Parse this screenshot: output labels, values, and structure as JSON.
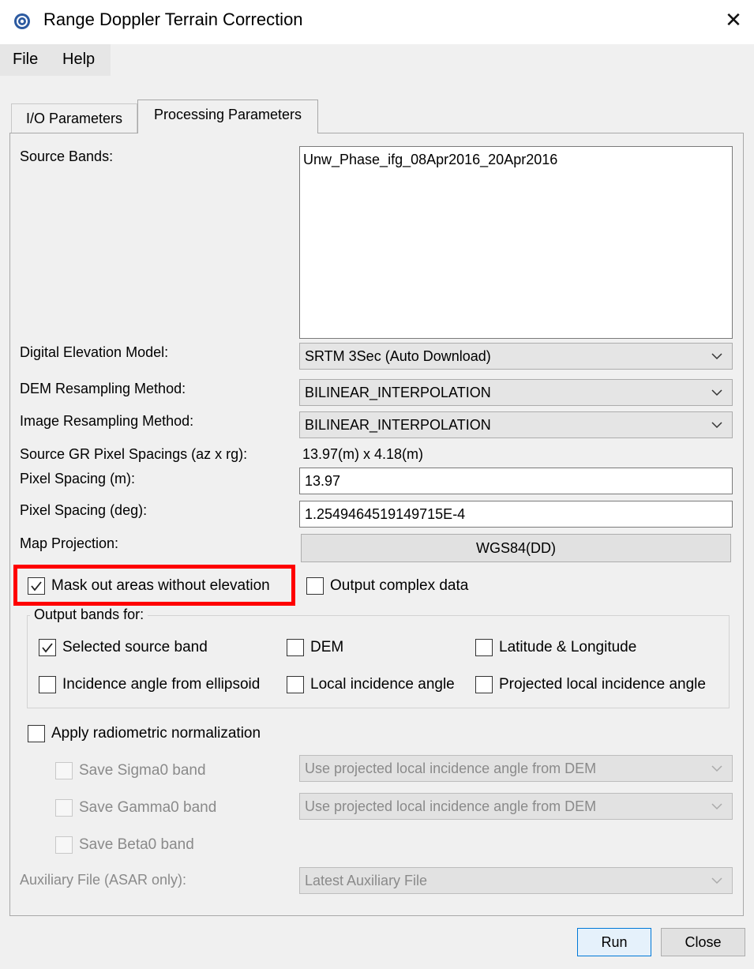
{
  "window": {
    "title": "Range Doppler Terrain Correction",
    "close_glyph": "✕"
  },
  "menu": {
    "file": "File",
    "help": "Help"
  },
  "tabs": {
    "io": "I/O Parameters",
    "processing": "Processing Parameters"
  },
  "form": {
    "source_bands_label": "Source Bands:",
    "source_bands": [
      "Unw_Phase_ifg_08Apr2016_20Apr2016"
    ],
    "dem_label": "Digital Elevation Model:",
    "dem_value": "SRTM 3Sec (Auto Download)",
    "dem_resampling_label": "DEM Resampling Method:",
    "dem_resampling_value": "BILINEAR_INTERPOLATION",
    "image_resampling_label": "Image Resampling Method:",
    "image_resampling_value": "BILINEAR_INTERPOLATION",
    "gr_spacing_label": "Source GR Pixel Spacings (az x rg):",
    "gr_spacing_value": "13.97(m) x 4.18(m)",
    "pixel_spacing_m_label": "Pixel Spacing (m):",
    "pixel_spacing_m_value": "13.97",
    "pixel_spacing_deg_label": "Pixel Spacing (deg):",
    "pixel_spacing_deg_value": "1.2549464519149715E-4",
    "map_projection_label": "Map Projection:",
    "map_projection_button": "WGS84(DD)",
    "mask_label": "Mask out areas without elevation",
    "mask_checked": true,
    "complex_label": "Output complex data",
    "complex_checked": false,
    "output_bands_title": "Output bands for:",
    "selected_source_label": "Selected source band",
    "selected_source_checked": true,
    "dem_band_label": "DEM",
    "latlon_label": "Latitude & Longitude",
    "incidence_ellipsoid_label": "Incidence angle from ellipsoid",
    "local_incidence_label": "Local incidence angle",
    "projected_local_label": "Projected local incidence angle",
    "radiometric_label": "Apply radiometric normalization",
    "sigma0_label": "Save Sigma0 band",
    "sigma0_combo": "Use projected local incidence angle from DEM",
    "gamma0_label": "Save Gamma0 band",
    "gamma0_combo": "Use projected local incidence angle from DEM",
    "beta0_label": "Save Beta0 band",
    "aux_label": "Auxiliary File (ASAR only):",
    "aux_combo": "Latest Auxiliary File"
  },
  "buttons": {
    "run": "Run",
    "close": "Close"
  },
  "colors": {
    "highlight": "#ff0000",
    "run_border": "#0078d7"
  }
}
